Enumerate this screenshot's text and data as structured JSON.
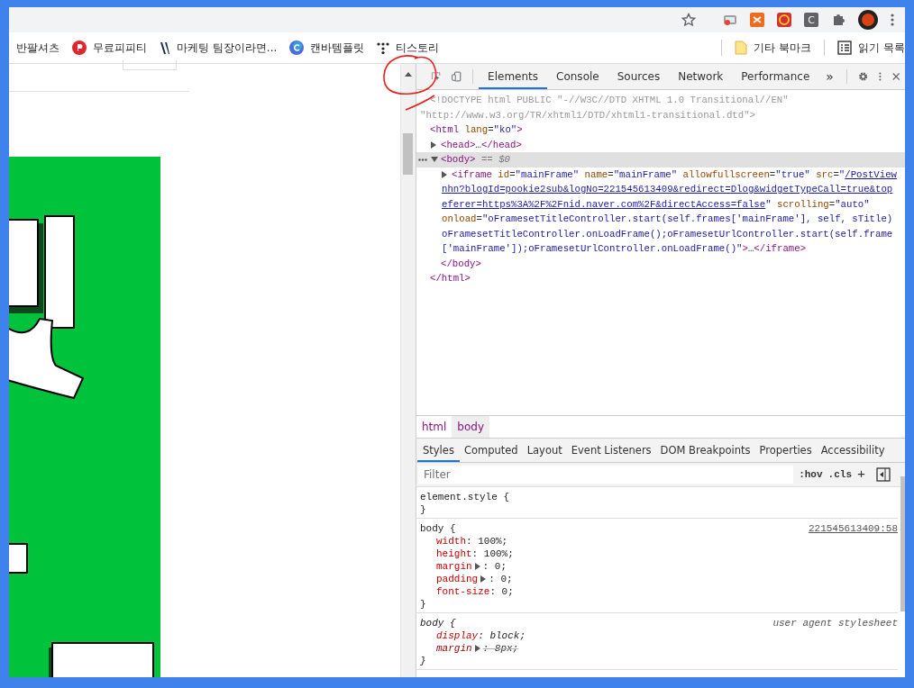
{
  "browser": {
    "extension_letter": "C"
  },
  "bookmarks": [
    {
      "label": "반팔셔츠"
    },
    {
      "label": "무료피피티",
      "kind": "pin"
    },
    {
      "label": "마케팅 팀장이라면...",
      "kind": "vee"
    },
    {
      "label": "캔바템플릿",
      "kind": "ring"
    },
    {
      "label": "티스토리",
      "kind": "dots"
    }
  ],
  "bookmarks_right": [
    {
      "label": "기타 북마크",
      "kind": "folder"
    },
    {
      "label": "읽기 목록",
      "kind": "list"
    }
  ],
  "devtools": {
    "tabs": [
      {
        "label": "Elements",
        "selected": true
      },
      {
        "label": "Console",
        "selected": false
      },
      {
        "label": "Sources",
        "selected": false
      },
      {
        "label": "Network",
        "selected": false
      },
      {
        "label": "Performance",
        "selected": false
      }
    ],
    "more_tabs": "»",
    "dom": [
      {
        "lines": [
          [
            {
              "kind": "comment",
              "text": "<!DOCTYPE html PUBLIC \"-//W3C//DTD XHTML 1.0 Transitional//EN\""
            }
          ],
          [
            {
              "kind": "comment",
              "text": "\"http://www.w3.org/TR/xhtml1/DTD/xhtml1-transitional.dtd\">"
            }
          ]
        ],
        "selected": false
      },
      {
        "lines": [
          [
            {
              "kind": "tag",
              "text": "<html"
            },
            {
              "kind": "attr",
              "text": " lang"
            },
            {
              "kind": "punct",
              "text": "="
            },
            {
              "kind": "value",
              "text": "\"ko\""
            },
            {
              "kind": "tag",
              "text": ">"
            }
          ]
        ],
        "selected": false,
        "children": [
          {
            "expanded": false,
            "selected": false,
            "lines": [
              [
                {
                  "kind": "tag",
                  "text": "<head>"
                },
                {
                  "kind": "punct",
                  "text": "…"
                },
                {
                  "kind": "tag",
                  "text": "</head>"
                }
              ]
            ]
          },
          {
            "expanded": true,
            "selected": true,
            "lines": [
              [
                {
                  "kind": "tag",
                  "text": "<body>"
                },
                {
                  "kind": "marker",
                  "text": " == $0"
                }
              ]
            ],
            "children": [
              {
                "expanded": false,
                "selected": false,
                "lines": [
                  [
                    {
                      "kind": "tag",
                      "text": "<iframe"
                    },
                    {
                      "kind": "attr",
                      "text": " id"
                    },
                    {
                      "kind": "punct",
                      "text": "="
                    },
                    {
                      "kind": "value",
                      "text": "\"mainFrame\""
                    },
                    {
                      "kind": "attr",
                      "text": " name"
                    },
                    {
                      "kind": "punct",
                      "text": "="
                    },
                    {
                      "kind": "value",
                      "text": "\"mainFrame\""
                    },
                    {
                      "kind": "attr",
                      "text": " allowfullscreen"
                    },
                    {
                      "kind": "punct",
                      "text": "="
                    },
                    {
                      "kind": "value",
                      "text": "\"true\""
                    },
                    {
                      "kind": "attr",
                      "text": " src"
                    },
                    {
                      "kind": "punct",
                      "text": "="
                    },
                    {
                      "kind": "value",
                      "text": "\""
                    },
                    {
                      "kind": "link",
                      "text": "/PostView"
                    }
                  ],
                  [
                    {
                      "kind": "link",
                      "text": "nhn?blogId=pookie2sub&logNo=221545613409&redirect=Dlog&widgetTypeCall=true&top"
                    }
                  ],
                  [
                    {
                      "kind": "link",
                      "text": "eferer=https%3A%2F%2Fnid.naver.com%2F&directAccess=false"
                    },
                    {
                      "kind": "value",
                      "text": "\""
                    },
                    {
                      "kind": "attr",
                      "text": " scrolling"
                    },
                    {
                      "kind": "punct",
                      "text": "="
                    },
                    {
                      "kind": "value",
                      "text": "\"auto\""
                    }
                  ],
                  [
                    {
                      "kind": "attr",
                      "text": "onload"
                    },
                    {
                      "kind": "punct",
                      "text": "="
                    },
                    {
                      "kind": "value",
                      "text": "\"oFramesetTitleController.start(self.frames['mainFrame'], self, sTitle)"
                    }
                  ],
                  [
                    {
                      "kind": "value",
                      "text": "oFramesetTitleController.onLoadFrame();oFramesetUrlController.start(self.frame"
                    }
                  ],
                  [
                    {
                      "kind": "value",
                      "text": "['mainFrame']);oFramesetUrlController.onLoadFrame()\""
                    },
                    {
                      "kind": "tag",
                      "text": ">"
                    },
                    {
                      "kind": "punct",
                      "text": "…"
                    },
                    {
                      "kind": "tag",
                      "text": "</iframe>"
                    }
                  ]
                ]
              }
            ],
            "close": [
              {
                "kind": "tag",
                "text": "</body>"
              }
            ]
          }
        ],
        "close": [
          {
            "kind": "tag",
            "text": "</html>"
          }
        ]
      }
    ],
    "breadcrumbs": [
      {
        "label": "html",
        "selected": false
      },
      {
        "label": "body",
        "selected": true
      }
    ],
    "style_tabs": [
      {
        "label": "Styles",
        "selected": true
      },
      {
        "label": "Computed",
        "selected": false
      },
      {
        "label": "Layout",
        "selected": false
      },
      {
        "label": "Event Listeners",
        "selected": false
      },
      {
        "label": "DOM Breakpoints",
        "selected": false
      },
      {
        "label": "Properties",
        "selected": false
      },
      {
        "label": "Accessibility",
        "selected": false
      }
    ],
    "filter": {
      "placeholder": "Filter"
    },
    "hov": ":hov",
    "cls": ".cls",
    "add": "+",
    "rules": [
      {
        "selector": "element.style",
        "open": "{",
        "close": "}",
        "kind": "inline"
      },
      {
        "selector": "body",
        "open": "{",
        "close": "}",
        "kind": "author",
        "source": "221545613409:58",
        "declarations": [
          {
            "property": "width",
            "value": ": 100%;",
            "expandable": false,
            "overridden": false
          },
          {
            "property": "height",
            "value": ": 100%;",
            "expandable": false,
            "overridden": false
          },
          {
            "property": "margin",
            "value": ": 0;",
            "expandable": true,
            "overridden": false
          },
          {
            "property": "padding",
            "value": ": 0;",
            "expandable": true,
            "overridden": false
          },
          {
            "property": "font-size",
            "value": ": 0;",
            "expandable": false,
            "overridden": false
          }
        ]
      },
      {
        "selector": "body",
        "open": "{",
        "close": "}",
        "kind": "agent",
        "source": "user agent stylesheet",
        "declarations": [
          {
            "property": "display",
            "value": ": block;",
            "expandable": false,
            "overridden": false
          },
          {
            "property": "margin",
            "value": ": 8px;",
            "expandable": true,
            "overridden": true
          }
        ]
      }
    ]
  }
}
